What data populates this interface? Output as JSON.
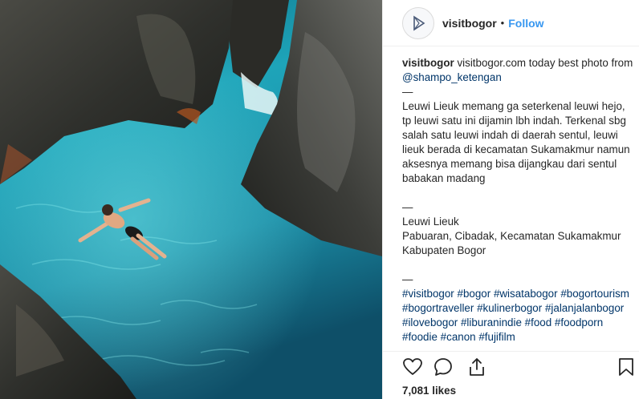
{
  "header": {
    "username": "visitbogor",
    "separator": "•",
    "follow_label": "Follow",
    "avatar_icon": "visitbogor-logo-icon"
  },
  "caption": {
    "username": "visitbogor",
    "intro": " visitbogor.com today best photo from ",
    "mention": "@shampo_ketengan",
    "divider": "—",
    "paragraph1": "Leuwi Lieuk memang ga seterkenal leuwi hejo, tp leuwi satu ini dijamin lbh indah. Terkenal sbg salah satu leuwi indah di daerah sentul, leuwi lieuk berada di kecamatan Sukamakmur namun aksesnya memang bisa dijangkau dari sentul babakan madang",
    "place_name": "Leuwi Lieuk",
    "address": "Pabuaran, Cibadak, Kecamatan Sukamakmur Kabupaten Bogor",
    "hashtags": [
      "#visitbogor",
      "#bogor",
      "#wisatabogor",
      "#bogortourism",
      "#bogortraveller",
      "#kulinerbogor",
      "#jalanjalanbogor",
      "#ilovebogor",
      "#liburanindie",
      "#food",
      "#foodporn",
      "#foodie",
      "#canon",
      "#fujifilm"
    ]
  },
  "actions": {
    "like_icon": "heart-icon",
    "comment_icon": "comment-icon",
    "share_icon": "share-icon",
    "save_icon": "bookmark-icon"
  },
  "likes_text": "7,081 likes",
  "colors": {
    "link": "#003569",
    "follow": "#3897f0",
    "text": "#262626",
    "water": "#1fa3b8"
  }
}
